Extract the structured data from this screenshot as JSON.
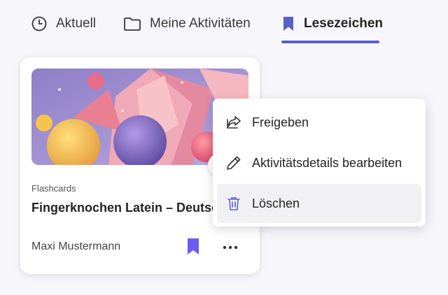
{
  "tabs": [
    {
      "label": "Aktuell",
      "icon": "clock-icon"
    },
    {
      "label": "Meine Aktivitäten",
      "icon": "folder-icon"
    },
    {
      "label": "Lesezeichen",
      "icon": "bookmark-icon",
      "active": true
    }
  ],
  "card": {
    "category": "Flashcards",
    "title": "Fingerknochen Latein – Deutsch",
    "author": "Maxi Mustermann",
    "bookmark_icon": "bookmark-filled-icon",
    "more_icon": "more-horizontal-icon"
  },
  "menu": {
    "items": [
      {
        "label": "Freigeben",
        "icon": "share-icon"
      },
      {
        "label": "Aktivitätsdetails bearbeiten",
        "icon": "pencil-icon"
      },
      {
        "label": "Löschen",
        "icon": "trash-icon",
        "highlighted": true
      }
    ]
  },
  "colors": {
    "accent": "#5b5fc7",
    "background": "#f7f7fb"
  }
}
